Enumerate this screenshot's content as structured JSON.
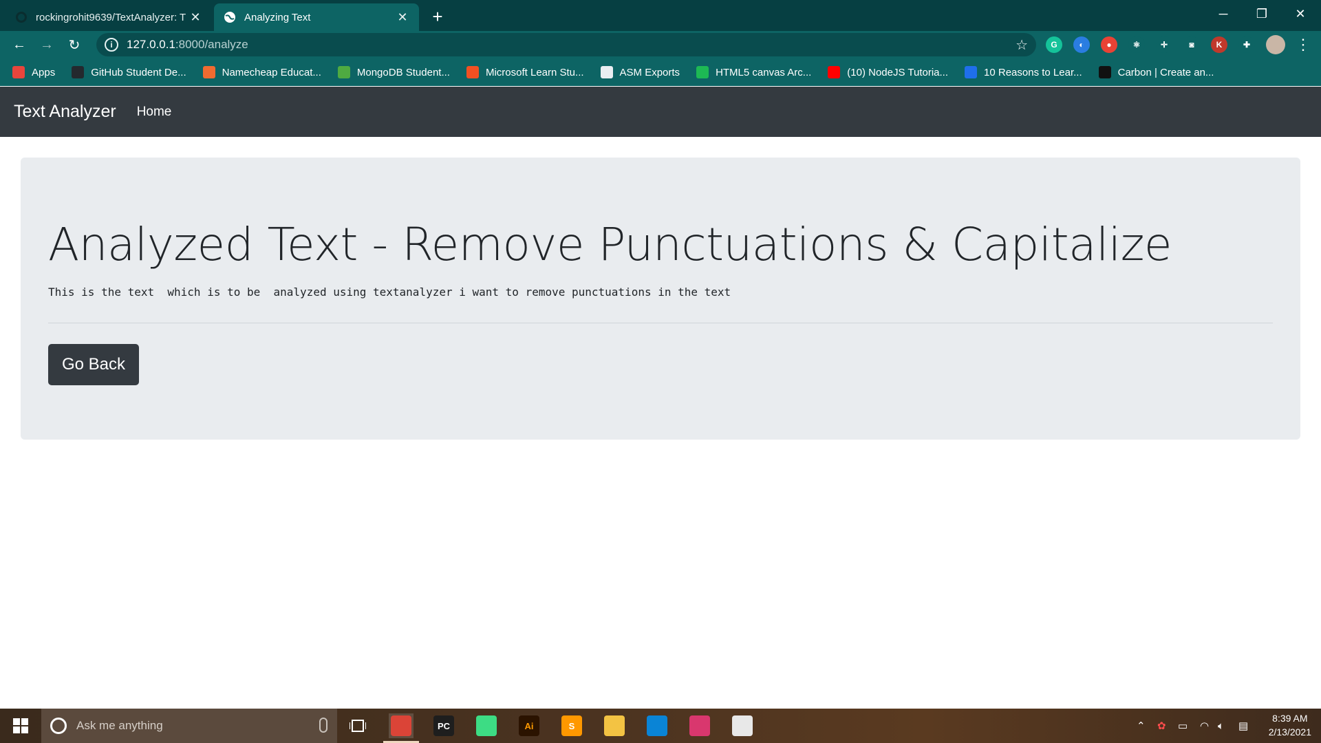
{
  "browser": {
    "tabs": [
      {
        "title": "rockingrohit9639/TextAnalyzer: T",
        "active": false
      },
      {
        "title": "Analyzing Text",
        "active": true
      }
    ],
    "address": {
      "host": "127.0.0.1",
      "path": ":8000/analyze"
    },
    "bookmarks": [
      {
        "label": "Apps",
        "icon": "apps-grid-icon",
        "color": "#e8453c"
      },
      {
        "label": "GitHub Student De...",
        "icon": "github-icon",
        "color": "#24292e"
      },
      {
        "label": "Namecheap Educat...",
        "icon": "namecheap-icon",
        "color": "#f06b31"
      },
      {
        "label": "MongoDB Student...",
        "icon": "mongodb-leaf-icon",
        "color": "#4faa41"
      },
      {
        "label": "Microsoft Learn Stu...",
        "icon": "microsoft-icon",
        "color": "#f25022"
      },
      {
        "label": "ASM Exports",
        "icon": "document-icon",
        "color": "#e9eef2"
      },
      {
        "label": "HTML5 canvas Arc...",
        "icon": "k-icon",
        "color": "#1db954"
      },
      {
        "label": "(10) NodeJS Tutoria...",
        "icon": "youtube-icon",
        "color": "#ff0000"
      },
      {
        "label": "10 Reasons to Lear...",
        "icon": "pb-icon",
        "color": "#1f6feb"
      },
      {
        "label": "Carbon | Create an...",
        "icon": "carbon-icon",
        "color": "#111111"
      }
    ],
    "extensions": [
      {
        "name": "grammarly-icon",
        "color": "#15c39a",
        "text": "G"
      },
      {
        "name": "sync-icon",
        "color": "#2a7de1",
        "text": "◐"
      },
      {
        "name": "color-wheel-icon",
        "color": "#e94235",
        "text": "●"
      },
      {
        "name": "react-icon",
        "color": "#0d6464",
        "text": "⚛"
      },
      {
        "name": "ruler-icon",
        "color": "#0d6464",
        "text": "✛"
      },
      {
        "name": "camera-icon",
        "color": "#0d6464",
        "text": "◙"
      },
      {
        "name": "k-extension-icon",
        "color": "#c0392b",
        "text": "K"
      },
      {
        "name": "puzzle-icon",
        "color": "#0d6464",
        "text": "✚"
      }
    ]
  },
  "page": {
    "brand": "Text Analyzer",
    "nav": {
      "home": "Home"
    },
    "heading": "Analyzed Text - Remove Punctuations & Capitalize",
    "result_text": "This is the text  which is to be  analyzed using textanalyzer i want to remove punctuations in the text",
    "back_button": "Go Back"
  },
  "taskbar": {
    "search_placeholder": "Ask me anything",
    "apps": [
      {
        "name": "chrome-icon",
        "label": "",
        "color": "#db4437",
        "active": true
      },
      {
        "name": "pycharm-icon",
        "label": "PC",
        "color": "#1e1e1e",
        "active": false
      },
      {
        "name": "android-studio-icon",
        "label": "",
        "color": "#3ddc84",
        "active": false
      },
      {
        "name": "illustrator-icon",
        "label": "Ai",
        "color": "#2b1300",
        "active": false
      },
      {
        "name": "sublime-text-icon",
        "label": "S",
        "color": "#ff9800",
        "active": false
      },
      {
        "name": "file-explorer-icon",
        "label": "",
        "color": "#f3c343",
        "active": false
      },
      {
        "name": "vscode-icon",
        "label": "",
        "color": "#0a84d6",
        "active": false
      },
      {
        "name": "snip-sketch-icon",
        "label": "",
        "color": "#d9376e",
        "active": false
      },
      {
        "name": "paint-icon",
        "label": "",
        "color": "#e8e8e8",
        "active": false
      }
    ],
    "time": "8:39 AM",
    "date": "2/13/2021"
  }
}
